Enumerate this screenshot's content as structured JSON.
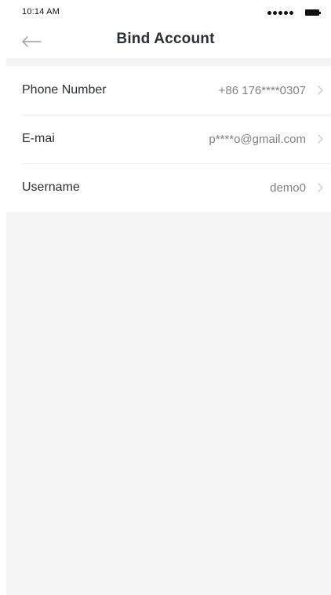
{
  "status_bar": {
    "time": "10:14 AM",
    "signal_icon": "signal-dots-icon",
    "battery_icon": "battery-icon"
  },
  "nav": {
    "back_icon": "arrow-left-icon",
    "title": "Bind Account"
  },
  "account_rows": [
    {
      "label": "Phone Number",
      "value": "+86  176****0307",
      "chevron_icon": "chevron-right-icon"
    },
    {
      "label": "E-mai",
      "value": "p****o@gmail.com",
      "chevron_icon": "chevron-right-icon"
    },
    {
      "label": "Username",
      "value": "demo0",
      "chevron_icon": "chevron-right-icon"
    }
  ],
  "colors": {
    "title_text": "#2b2f36",
    "value_text": "#7d8088",
    "background": "#f5f5f5",
    "divider": "#ececec",
    "chevron": "#c8cacf"
  }
}
